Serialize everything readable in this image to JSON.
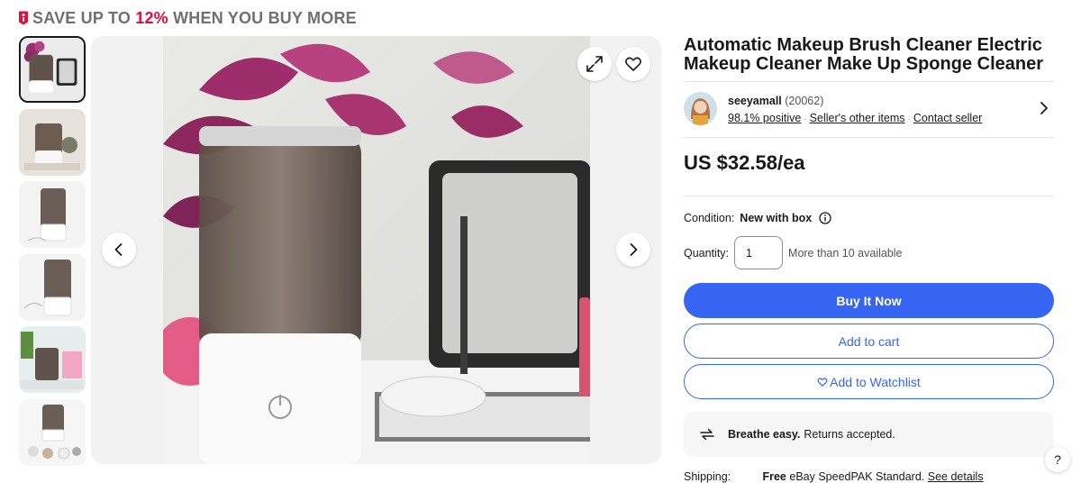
{
  "promo": {
    "prefix": "SAVE UP TO",
    "percent": "12%",
    "suffix": "WHEN YOU BUY MORE"
  },
  "listing": {
    "title": "Automatic Makeup Brush Cleaner Electric Makeup Cleaner Make Up Sponge Cleaner",
    "price": "US $32.58/ea"
  },
  "seller": {
    "name": "seeyamall",
    "feedback_count": "(20062)",
    "positive": "98.1% positive",
    "other_items": "Seller's other items",
    "contact": "Contact seller"
  },
  "condition": {
    "label": "Condition:",
    "value": "New with box"
  },
  "quantity": {
    "label": "Quantity:",
    "value": "1",
    "available": "More than 10 available"
  },
  "buttons": {
    "buy_now": "Buy It Now",
    "add_to_cart": "Add to cart",
    "add_to_watchlist": "Add to Watchlist"
  },
  "returns": {
    "bold": "Breathe easy.",
    "text": "Returns accepted."
  },
  "shipping": {
    "label": "Shipping:",
    "free": "Free",
    "service": "eBay SpeedPAK Standard.",
    "details_link": "See details"
  },
  "help": {
    "label": "?"
  },
  "icons": {
    "promo": "price-tag-icon",
    "expand": "expand-icon",
    "watch": "heart-icon",
    "prev": "chevron-left-icon",
    "next": "chevron-right-icon",
    "seller_chevron": "chevron-right-icon",
    "info": "info-icon",
    "returns": "returns-arrows-icon"
  },
  "colors": {
    "accent": "#3665f3",
    "promo_highlight": "#e0103a",
    "promo_text": "#707070",
    "text": "#191919"
  },
  "gallery": {
    "thumbnail_count": 6,
    "active_index": 0
  }
}
